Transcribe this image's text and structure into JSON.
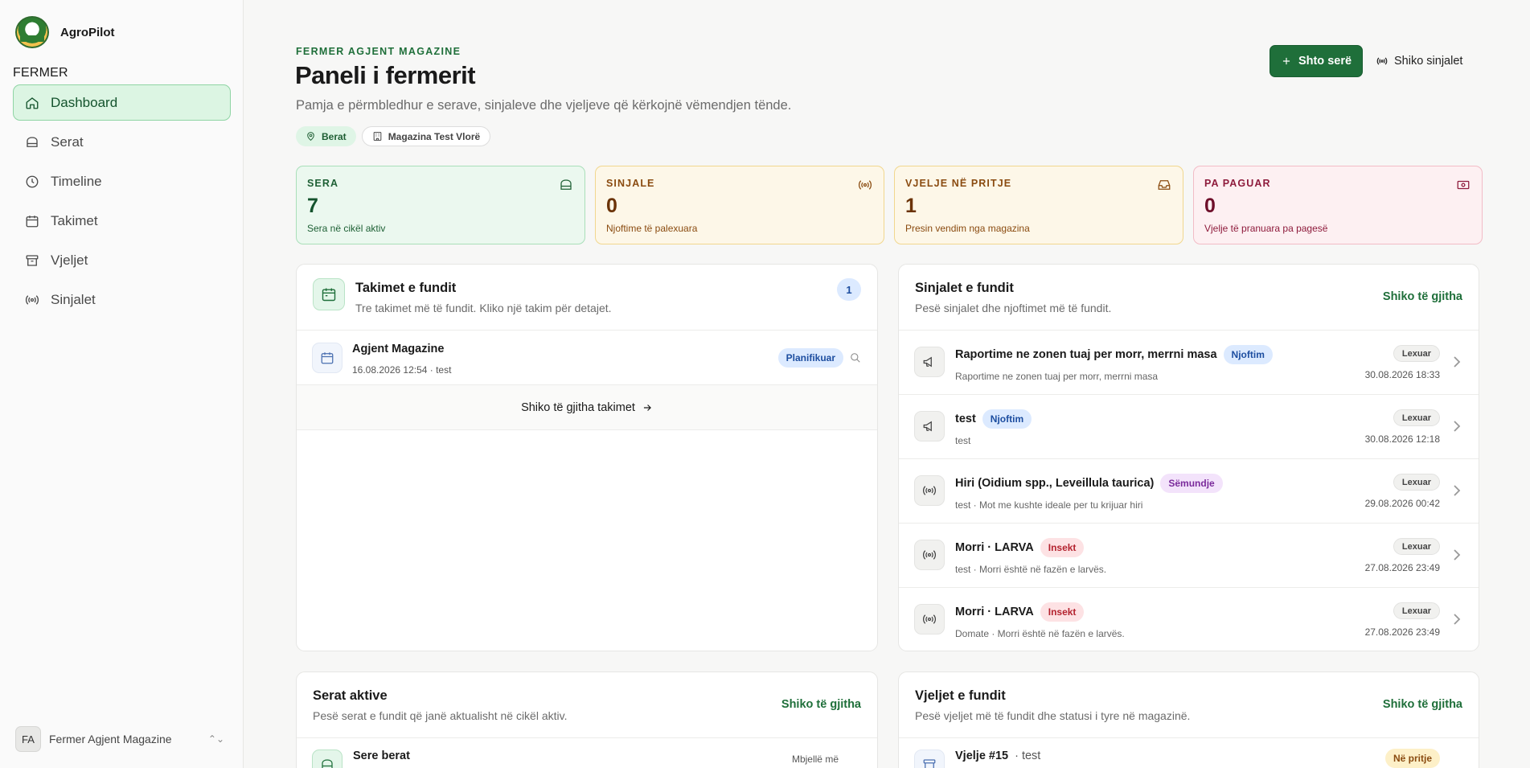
{
  "sidebar": {
    "brand": "AgroPilot",
    "section_label": "FERMER",
    "items": [
      {
        "label": "Dashboard",
        "icon": "home-icon"
      },
      {
        "label": "Serat",
        "icon": "greenhouse-icon"
      },
      {
        "label": "Timeline",
        "icon": "clock-icon"
      },
      {
        "label": "Takimet",
        "icon": "calendar-icon"
      },
      {
        "label": "Vjeljet",
        "icon": "archive-icon"
      },
      {
        "label": "Sinjalet",
        "icon": "signal-icon"
      }
    ],
    "user": {
      "initials": "FA",
      "name": "Fermer Agjent Magazine"
    }
  },
  "header": {
    "eyebrow": "FERMER AGJENT MAGAZINE",
    "title": "Paneli i fermerit",
    "subtitle": "Pamja e përmbledhur e serave, sinjaleve dhe vjeljeve që kërkojnë vëmendjen tënde.",
    "chip_location": "Berat",
    "chip_store": "Magazina Test Vlorë",
    "add_button": "Shto serë",
    "signals_button": "Shiko sinjalet"
  },
  "stats": [
    {
      "label": "SERA",
      "value": "7",
      "desc": "Sera në cikël aktiv"
    },
    {
      "label": "SINJALE",
      "value": "0",
      "desc": "Njoftime të palexuara"
    },
    {
      "label": "VJELJE NË PRITJE",
      "value": "1",
      "desc": "Presin vendim nga magazina"
    },
    {
      "label": "PA PAGUAR",
      "value": "0",
      "desc": "Vjelje të pranuara pa pagesë"
    }
  ],
  "appointments": {
    "title": "Takimet e fundit",
    "subtitle": "Tre takimet më të fundit. Kliko një takim për detajet.",
    "count": "1",
    "items": [
      {
        "title": "Agjent Magazine",
        "sub": "16.08.2026 12:54 · test",
        "status": "Planifikuar"
      }
    ],
    "view_all": "Shiko të gjitha takimet"
  },
  "signals": {
    "title": "Sinjalet e fundit",
    "subtitle": "Pesë sinjalet dhe njoftimet më të fundit.",
    "link": "Shiko të gjitha",
    "items": [
      {
        "title": "Raportime ne zonen tuaj per morr, merrni masa",
        "tag": "Njoftim",
        "sub": "Raportime ne zonen tuaj per morr, merrni masa",
        "state": "Lexuar",
        "date": "30.08.2026 18:33"
      },
      {
        "title": "test",
        "tag": "Njoftim",
        "sub": "test",
        "state": "Lexuar",
        "date": "30.08.2026 12:18"
      },
      {
        "title": "Hiri (Oidium spp., Leveillula taurica)",
        "tag": "Sëmundje",
        "sub": "test · Mot me kushte ideale per tu krijuar hiri",
        "state": "Lexuar",
        "date": "29.08.2026 00:42"
      },
      {
        "title": "Morri · LARVA",
        "tag": "Insekt",
        "sub": "test · Morri është në fazën e larvës.",
        "state": "Lexuar",
        "date": "27.08.2026 23:49"
      },
      {
        "title": "Morri · LARVA",
        "tag": "Insekt",
        "sub": "Domate · Morri është në fazën e larvës.",
        "state": "Lexuar",
        "date": "27.08.2026 23:49"
      }
    ]
  },
  "greenhouses": {
    "title": "Serat aktive",
    "subtitle": "Pesë serat e fundit që janë aktualisht në cikël aktiv.",
    "link": "Shiko të gjitha",
    "first_item": "Sere berat",
    "first_item_state": "Mbjellë më"
  },
  "harvests": {
    "title": "Vjeljet e fundit",
    "subtitle": "Pesë vjeljet më të fundit dhe statusi i tyre në magazinë.",
    "link": "Shiko të gjitha",
    "first_item": "Vjelje #15",
    "first_item_extra": "· test",
    "first_item_status": "Në pritje"
  },
  "colors": {
    "accent": "#1f6f3a",
    "active_nav_bg": "#dcf5e3"
  }
}
